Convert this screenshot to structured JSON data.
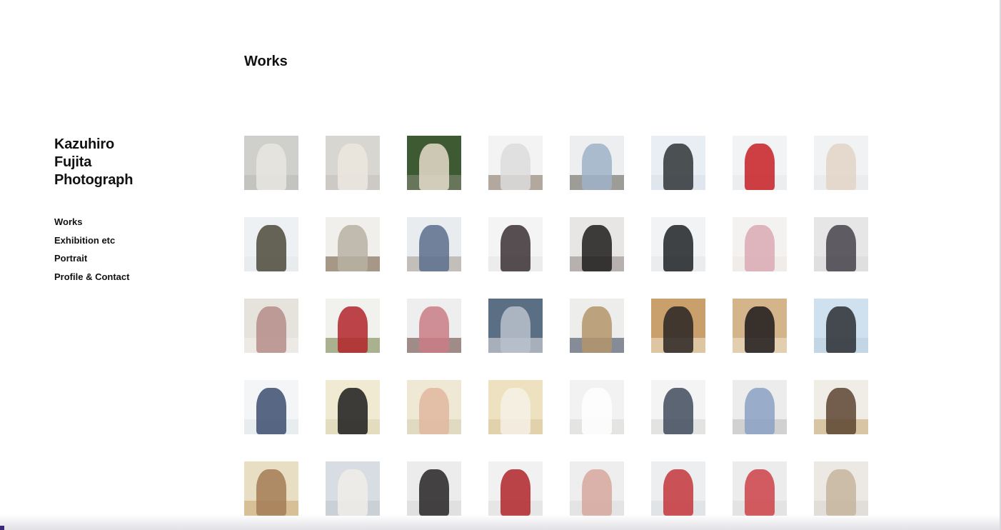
{
  "site": {
    "title": "Kazuhiro\nFujita\nPhotograph"
  },
  "nav": {
    "items": [
      {
        "label": "Works",
        "key": "works"
      },
      {
        "label": "Exhibition etc",
        "key": "exhibition"
      },
      {
        "label": "Portrait",
        "key": "portrait"
      },
      {
        "label": "Profile & Contact",
        "key": "profile-contact"
      }
    ]
  },
  "page": {
    "title": "Works"
  },
  "thumbnails": [
    {
      "bg": "#cfcfcc",
      "accent": "#e9e6e0",
      "floor": "#b9b9b6"
    },
    {
      "bg": "#d8d6d1",
      "accent": "#ece8df",
      "floor": "#c4c1bb"
    },
    {
      "bg": "#3d5a32",
      "accent": "#e5dccb",
      "floor": "#8a8c7e"
    },
    {
      "bg": "#f3f3f3",
      "accent": "#dcdcdc",
      "floor": "#7c6a55"
    },
    {
      "bg": "#eceeef",
      "accent": "#9fb2c8",
      "floor": "#5e5a4c"
    },
    {
      "bg": "#e8eef3",
      "accent": "#2f3436",
      "floor": "#d7e0e8"
    },
    {
      "bg": "#f2f3f4",
      "accent": "#c81e24",
      "floor": "#e6e8ea"
    },
    {
      "bg": "#f1f2f3",
      "accent": "#e3d5c7",
      "floor": "#e6e8ea"
    },
    {
      "bg": "#eef1f4",
      "accent": "#4c4a3a",
      "floor": "#e3e7eb"
    },
    {
      "bg": "#f0efec",
      "accent": "#b7b2a3",
      "floor": "#6b4f35"
    },
    {
      "bg": "#e9ecef",
      "accent": "#5c6f8d",
      "floor": "#a39b8f"
    },
    {
      "bg": "#f4f4f4",
      "accent": "#3a3032",
      "floor": "#e6e6e6"
    },
    {
      "bg": "#e8e6e4",
      "accent": "#1e1c1c",
      "floor": "#8c8482"
    },
    {
      "bg": "#f1f3f4",
      "accent": "#1f2224",
      "floor": "#e3e6e8"
    },
    {
      "bg": "#f3f2f0",
      "accent": "#d9a9b4",
      "floor": "#ece8e4"
    },
    {
      "bg": "#e6e6e6",
      "accent": "#45434a",
      "floor": "#d8d8d8"
    },
    {
      "bg": "#e6e3dd",
      "accent": "#b58d88",
      "floor": "#f2efe9"
    },
    {
      "bg": "#f1f2ee",
      "accent": "#b3262a",
      "floor": "#6e7c3f"
    },
    {
      "bg": "#eeeeee",
      "accent": "#c97b86",
      "floor": "#5e3b35"
    },
    {
      "bg": "#5a6e84",
      "accent": "#b8c2cb",
      "floor": "#e7e7e7"
    },
    {
      "bg": "#ededeb",
      "accent": "#b3956b",
      "floor": "#2f3c52"
    },
    {
      "bg": "#c9a06b",
      "accent": "#2a2523",
      "floor": "#f0e6d2"
    },
    {
      "bg": "#d4b48a",
      "accent": "#1c1a1a",
      "floor": "#efe4cf"
    },
    {
      "bg": "#cfe0ee",
      "accent": "#2b2e33",
      "floor": "#b8cddf"
    },
    {
      "bg": "#f3f5f7",
      "accent": "#3c4d6f",
      "floor": "#dde4ea"
    },
    {
      "bg": "#f0ead3",
      "accent": "#1c1c1c",
      "floor": "#d8cfae"
    },
    {
      "bg": "#efe8d4",
      "accent": "#e0b7a0",
      "floor": "#d6cdb2"
    },
    {
      "bg": "#ede1bf",
      "accent": "#f6f1e6",
      "floor": "#d8c79b"
    },
    {
      "bg": "#f2f2f2",
      "accent": "#ffffff",
      "floor": "#d9d9d6"
    },
    {
      "bg": "#f4f4f4",
      "accent": "#414b5c",
      "floor": "#d6d6d4"
    },
    {
      "bg": "#ececec",
      "accent": "#8ba2c4",
      "floor": "#bcbcbc"
    },
    {
      "bg": "#f0ede6",
      "accent": "#5d4431",
      "floor": "#c2a46c"
    },
    {
      "bg": "#e8dec3",
      "accent": "#a37b55",
      "floor": "#c9a770"
    },
    {
      "bg": "#d7dde3",
      "accent": "#f1ede8",
      "floor": "#bfc6cc"
    },
    {
      "bg": "#ececec",
      "accent": "#262323",
      "floor": "#d7d7d7"
    },
    {
      "bg": "#f1f1f1",
      "accent": "#b0242a",
      "floor": "#dcdcdc"
    },
    {
      "bg": "#efeeee",
      "accent": "#d7a79d",
      "floor": "#dcdcdc"
    },
    {
      "bg": "#eceeef",
      "accent": "#c4353a",
      "floor": "#d9dcde"
    },
    {
      "bg": "#ececed",
      "accent": "#cc4247",
      "floor": "#dcdcdd"
    },
    {
      "bg": "#ece9e4",
      "accent": "#c6b59c",
      "floor": "#d9d5cf"
    }
  ]
}
